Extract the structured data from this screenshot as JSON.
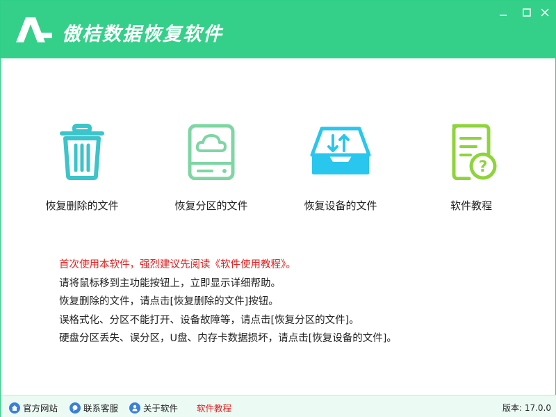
{
  "app": {
    "title": "傲桔数据恢复软件",
    "brand_color": "#34d08a"
  },
  "window_controls": {
    "minimize": "minimize-icon",
    "maximize": "maximize-icon",
    "close": "close-icon"
  },
  "cards": [
    {
      "label": "恢复删除的文件",
      "icon": "trash-can-icon",
      "color": "#3bc4c9"
    },
    {
      "label": "恢复分区的文件",
      "icon": "cloud-disk-icon",
      "color": "#7ed6a4"
    },
    {
      "label": "恢复设备的文件",
      "icon": "inbox-transfer-icon",
      "color": "#29c6ee"
    },
    {
      "label": "软件教程",
      "icon": "document-help-icon",
      "color": "#8fd43c"
    }
  ],
  "help": {
    "line1": "首次使用本软件，强烈建议先阅读《软件使用教程》。",
    "line2": "请将鼠标移到主功能按钮上，立即显示详细帮助。",
    "line3": "恢复删除的文件，请点击[恢复删除的文件]按钮。",
    "line4": "误格式化、分区不能打开、设备故障等，请点击[恢复分区的文件]。",
    "line5": "硬盘分区丢失、误分区，U盘、内存卡数据损坏，请点击[恢复设备的文件]。",
    "warn_color": "#e02020"
  },
  "statusbar": {
    "website": "官方网站",
    "support": "联系客服",
    "about": "关于软件",
    "tutorial": "软件教程",
    "version": "版本: 17.0.0"
  }
}
